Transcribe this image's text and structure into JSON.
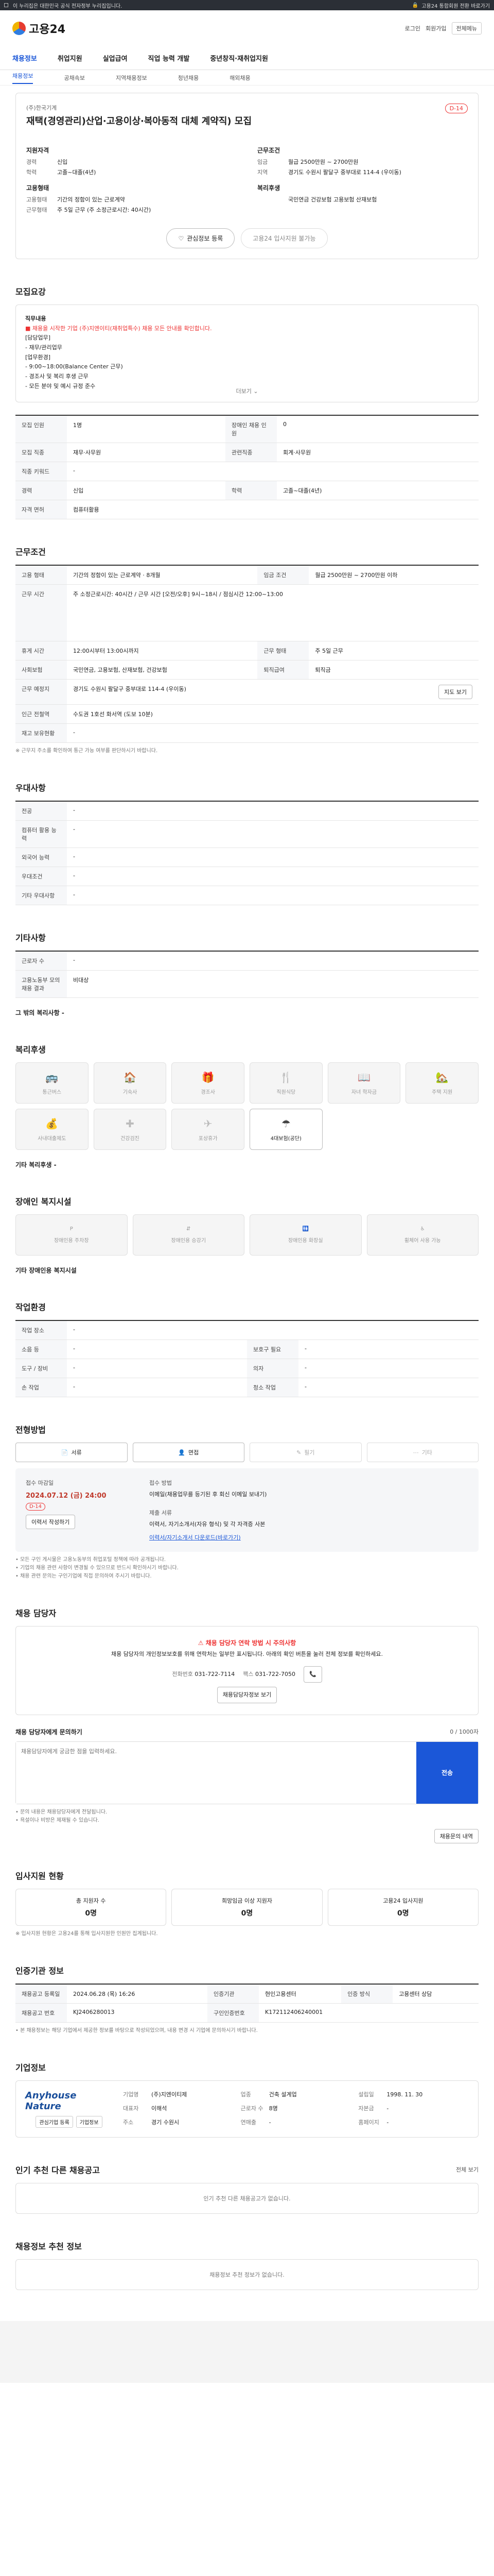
{
  "topbar": {
    "notice": "이 누리집은 대한민국 공식 전자정부 누리집입니다.",
    "left": "세로",
    "login_icon": "lock-icon",
    "right_links": [
      "고용24 통합회원 전환 바로가기"
    ]
  },
  "header": {
    "logo_text": "고용24",
    "links": [
      "로그인",
      "회원가입",
      "전체메뉴"
    ]
  },
  "gnb": [
    "채용정보",
    "취업지원",
    "실업급여",
    "직업 능력 개발",
    "중년창직·재취업지원"
  ],
  "subgnb": [
    "채용정보",
    "공채속보",
    "지역채용정보",
    "청년채용",
    "해외채용"
  ],
  "job": {
    "company": "(주)한국기계",
    "title": "재택(경영관리)산업·고용이상·복아동적 대체 계약직) 모집",
    "dday": "D-14",
    "left": {
      "section1": "지원자격",
      "rows1": [
        [
          "경력",
          "신입"
        ],
        [
          "학력",
          "고졸~대졸(4년)"
        ]
      ],
      "section2": "고용형태",
      "rows2": [
        [
          "고용형태",
          "기간의 정함이 있는 근로계약"
        ],
        [
          "근무형태",
          "주 5일 근무 (주 소정근로시간: 40시간)"
        ]
      ]
    },
    "right": {
      "section1": "근무조건",
      "rows1": [
        [
          "임금",
          "월급 2500만원 ~ 2700만원"
        ],
        [
          "지역",
          "경기도 수원시 팔달구 중부대로 114-4 (우이동)"
        ]
      ],
      "section2": "복리후생",
      "rows2": [
        [
          "",
          "국민연금 건강보험 고용보험 산재보험"
        ]
      ]
    },
    "btn_apply": "관심정보 등록",
    "btn_share": "고용24 입사지원 불가능"
  },
  "recruit": {
    "heading": "모집요강",
    "notice_lines": [
      "직무내용",
      "■ 채용을 시작한 기업 (주)지엔이티(재취업특수) 채용 모든 안내를 확인합니다.",
      "[담당업무]",
      "- 재무/관리업무",
      "[업무환경]",
      "- 9:00~18:00(Balance Center 근무)",
      "- 경조사 및 복리 후생 근무",
      "- 모든 분야 및 예시 규정 준수"
    ],
    "more": "더보기",
    "table": [
      [
        "모집 인원",
        "1명",
        "장애인 채용 인원",
        "0"
      ],
      [
        "모집 직종",
        "재무·사무원",
        "관련직종",
        "회계·사무원"
      ],
      [
        "직종 키워드",
        "-",
        "",
        ""
      ],
      [
        "경력",
        "신입",
        "학력",
        "고졸~대졸(4년)"
      ],
      [
        "자격 면허",
        "컴퓨터활용",
        "",
        ""
      ]
    ]
  },
  "conditions": {
    "heading": "근무조건",
    "rows": [
      [
        "고용 형태",
        "기간의 정함이 있는 근로계약 · 8개월",
        "임금 조건",
        "월급 2500만원 ~ 2700만원 이하"
      ],
      [
        "근무 시간",
        "주 소정근로시간: 40시간 / 근무 시간 [오전/오후] 9시~18시 / 점심시간 12:00~13:00",
        "",
        ""
      ],
      [
        "휴게 시간",
        "12:00시부터 13:00시까지",
        "근무 형태",
        "주 5일 근무"
      ],
      [
        "사회보험",
        "국민연금, 고용보험, 산재보험, 건강보험",
        "퇴직급여",
        "퇴직금"
      ],
      [
        "근무 예정지",
        "경기도 수원시 팔달구 중부대로 114-4 (우이동)",
        "",
        ""
      ],
      [
        "인근 전철역",
        "수도권 1호선 화서역 (도보 10분)",
        "",
        ""
      ],
      [
        "재고 보유현황",
        "-",
        "",
        ""
      ]
    ],
    "note": "※ 근무지 주소를 확인하여 통근 가능 여부를 판단하시기 바랍니다."
  },
  "preferred": {
    "heading": "우대사항",
    "rows": [
      [
        "전공",
        "-"
      ],
      [
        "컴퓨터 활용 능력",
        "-"
      ],
      [
        "외국어 능력",
        "-"
      ],
      [
        "우대조건",
        "-"
      ],
      [
        "기타 우대사항",
        "-"
      ]
    ]
  },
  "etc": {
    "heading": "기타사항",
    "rows": [
      [
        "근로자 수",
        "-"
      ],
      [
        "고용노동부 모의 채용 결과",
        "비대상"
      ]
    ],
    "extra": "그 밖의 복리사항 -"
  },
  "welfare": {
    "heading": "복리후생",
    "items": [
      {
        "label": "통근버스",
        "icon": "bus-icon",
        "on": false
      },
      {
        "label": "기숙사",
        "icon": "home-icon",
        "on": false
      },
      {
        "label": "경조사",
        "icon": "gift-icon",
        "on": false
      },
      {
        "label": "직원식당",
        "icon": "meal-icon",
        "on": false
      },
      {
        "label": "자녀 학자금",
        "icon": "book-icon",
        "on": false
      },
      {
        "label": "주택 지원",
        "icon": "house-icon",
        "on": false
      },
      {
        "label": "사내대출제도",
        "icon": "money-icon",
        "on": false
      },
      {
        "label": "건강검진",
        "icon": "health-icon",
        "on": false
      },
      {
        "label": "포상휴가",
        "icon": "travel-icon",
        "on": false
      },
      {
        "label": "4대보험(공단)",
        "icon": "insurance-icon",
        "on": true
      }
    ],
    "extra": "기타 복리후생 -"
  },
  "barrier": {
    "heading": "장애인 복지시설",
    "items": [
      {
        "label": "장애인용 주차장",
        "icon": "parking-icon"
      },
      {
        "label": "장애인용 승강기",
        "icon": "elevator-icon"
      },
      {
        "label": "장애인용 화장실",
        "icon": "toilet-icon"
      },
      {
        "label": "휠체어 사용 가능",
        "icon": "wheelchair-icon"
      }
    ],
    "extra": "기타 장애인용 복지시설"
  },
  "env": {
    "heading": "작업환경",
    "rows": [
      [
        "작업 장소",
        "-",
        "",
        ""
      ],
      [
        "소음 등",
        "-",
        "보호구 필요",
        "-"
      ],
      [
        "도구 / 장비",
        "-",
        "의자",
        "-"
      ],
      [
        "손 작업",
        "-",
        "청소 작업",
        "-"
      ]
    ]
  },
  "screening": {
    "heading": "전형방법",
    "methods": [
      {
        "label": "서류",
        "icon": "document-icon",
        "on": true
      },
      {
        "label": "면접",
        "icon": "person-icon",
        "on": true
      },
      {
        "label": "필기",
        "icon": "pen-icon",
        "on": false
      },
      {
        "label": "기타",
        "icon": "more-icon",
        "on": false
      }
    ],
    "deadline_label": "접수 마감일",
    "deadline": "2024.07.12 (금) 24:00",
    "dday": "D-14",
    "calendar_btn": "이력서 작성하기",
    "method_label": "접수 방법",
    "method_text": "이메일(채용업무를 등기된 후 회신 이메일 보내기)",
    "submit_label": "제출 서류",
    "submit_text": "이력서, 자기소개서(자유 형식) 및 각 자격증 사본",
    "link_text": "이력서/자기소개서 다운로드(바로가기)",
    "notes": [
      "• 모든 구인 게시물은 고용노동부의 취업포털 정책에 따라 공개됩니다.",
      "• 기업의 채용 관련 사항이 변경될 수 있으므로 반드시 확인하시기 바랍니다.",
      "• 채용 관련 문의는 구인기업에 직접 문의하여 주시기 바랍니다."
    ]
  },
  "contact": {
    "heading": "채용 담당자",
    "warn_title": "채용 담당자 연락 방법 시 주의사항",
    "warn_text": "채용 담당자의 개인정보보호를 위해 연락처는 일부만 표시됩니다. 아래의 확인 버튼을 눌러 전체 정보를 확인하세요.",
    "phone_label": "전화번호",
    "phone": "031-722-7114",
    "fax_label": "팩스",
    "fax": "031-722-7050",
    "reveal_btn": "채용담당자정보 보기",
    "inquiry_heading": "채용 담당자에게 문의하기",
    "inquiry_count": "0 / 1000자",
    "inquiry_placeholder": "채용담당자에게 궁금한 점을 입력하세요.",
    "inquiry_send": "전송",
    "inquiry_notes": [
      "• 문의 내용은 채용담당자에게 전달됩니다.",
      "• 욕설이나 비방은 제재될 수 있습니다."
    ],
    "inquiry_more": "채용문의 내역"
  },
  "stats": {
    "heading": "입사지원 현황",
    "items": [
      {
        "label": "총 지원자 수",
        "value": "0명"
      },
      {
        "label": "희망임금 이상 지원자",
        "value": "0명"
      },
      {
        "label": "고용24 입사지원",
        "value": "0명"
      }
    ],
    "note": "※ 입사지원 현황은 고용24를 통해 입사지원한 인원만 집계됩니다."
  },
  "info": {
    "heading": "인증기관 정보",
    "rows": [
      [
        "채용공고 등록일",
        "2024.06.28 (목) 16:26",
        "인증기관",
        "현인고용센터",
        "인증 방식",
        "고용센터 상담"
      ],
      [
        "채용공고 번호",
        "KJ2406280013",
        "구인인증번호",
        "K172112406240001",
        "",
        ""
      ]
    ],
    "notes": [
      "• 본 채용정보는 해당 기업에서 제공한 정보를 바탕으로 작성되었으며, 내용 변경 시 기업에 문의하시기 바랍니다."
    ]
  },
  "company": {
    "heading": "기업정보",
    "logo_text": "Anyhouse Nature",
    "btns": [
      "관심기업 등록",
      "기업정보"
    ],
    "fields": [
      [
        "기업명",
        "(주)지엔이티제"
      ],
      [
        "업종",
        "건축 설계업"
      ],
      [
        "설립일",
        "1998. 11. 30"
      ],
      [
        "대표자",
        "이해석"
      ],
      [
        "근로자 수",
        "8명"
      ],
      [
        "자본금",
        "-"
      ],
      [
        "주소",
        "경기 수원시"
      ],
      [
        "연매출",
        "-"
      ],
      [
        "홈페이지",
        "-"
      ]
    ]
  },
  "similar": {
    "heading": "인기 추천 다른 채용공고",
    "empty": "인기 추천 다른 채용공고가 없습니다.",
    "more_link": "전체 보기"
  },
  "recommend": {
    "heading": "채용정보 추천 정보",
    "empty": "채용정보 추천 정보가 없습니다."
  }
}
